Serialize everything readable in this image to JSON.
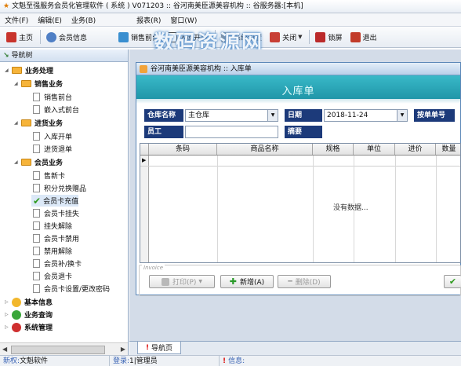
{
  "titlebar": {
    "text": "文魁至强服务会员化管理软件 ( 系统 ) V071203 :: 谷河南美臣源美容机构 :: 谷服务器:[本机]"
  },
  "menu": {
    "items": [
      "文件(F)",
      "编辑(E)",
      "业务(B)",
      "报表(R)",
      "窗口(W)"
    ]
  },
  "toolbar": {
    "items": [
      {
        "label": "主页",
        "color": "#c8342c"
      },
      {
        "label": "会员信息",
        "color": "#4f7fc5"
      },
      {
        "label": "销售前台",
        "color": "#3a8fd0"
      },
      {
        "label": "入库开单",
        "color": "#4a4a4a"
      },
      {
        "label": "系统设置",
        "color": "#7b7b7b"
      },
      {
        "label": "关闭",
        "color": "#c83f35"
      },
      {
        "label": "锁屏",
        "color": "#bb2a2a"
      },
      {
        "label": "退出",
        "color": "#c23c2a"
      }
    ]
  },
  "watermark": "数码资源网",
  "sidebar": {
    "title": "导航树",
    "tree": {
      "biz": "业务处理",
      "sales": "销售业务",
      "sales_front": "销售前台",
      "embed_front": "嵌入式前台",
      "purchase": "进货业务",
      "in_order": "入库开单",
      "return_order": "进货退单",
      "member": "会员业务",
      "card_new": "售新卡",
      "points_gift": "积分兑换赠品",
      "card_charge": "会员卡充值",
      "card_lost": "会员卡挂失",
      "unlost": "挂失解除",
      "card_disable": "会员卡禁用",
      "undisable": "禁用解除",
      "card_replace": "会员补/换卡",
      "card_return": "会员退卡",
      "card_pwd": "会员卡设置/更改密码",
      "basic_info": "基本信息",
      "biz_query": "业务查询",
      "sys_mgmt": "系统管理"
    }
  },
  "child": {
    "title": "谷河南美臣源美容机构 :: 入库单",
    "banner": "入库单",
    "warehouse_label": "仓库名称",
    "warehouse_value": "主仓库",
    "date_label": "日期",
    "date_value": "2018-11-24",
    "order_no_label": "按单单号",
    "staff_label": "员工",
    "staff_value": "",
    "memo_label": "摘要",
    "columns": [
      "条码",
      "商品名称",
      "规格",
      "单位",
      "进价",
      "数量"
    ],
    "empty_text": "没有数据...",
    "invoice_label": "Invoice",
    "print_label": "打印(P)",
    "add_label": "新增(A)",
    "delete_label": "删除(D)"
  },
  "wintab": {
    "label": "导航页"
  },
  "statusbar": {
    "n_label": "新权:",
    "n_value": "文魁软件",
    "login_label": "登录:",
    "login_value": "1|管理员",
    "info_label": "信息:",
    "info_value": ""
  }
}
